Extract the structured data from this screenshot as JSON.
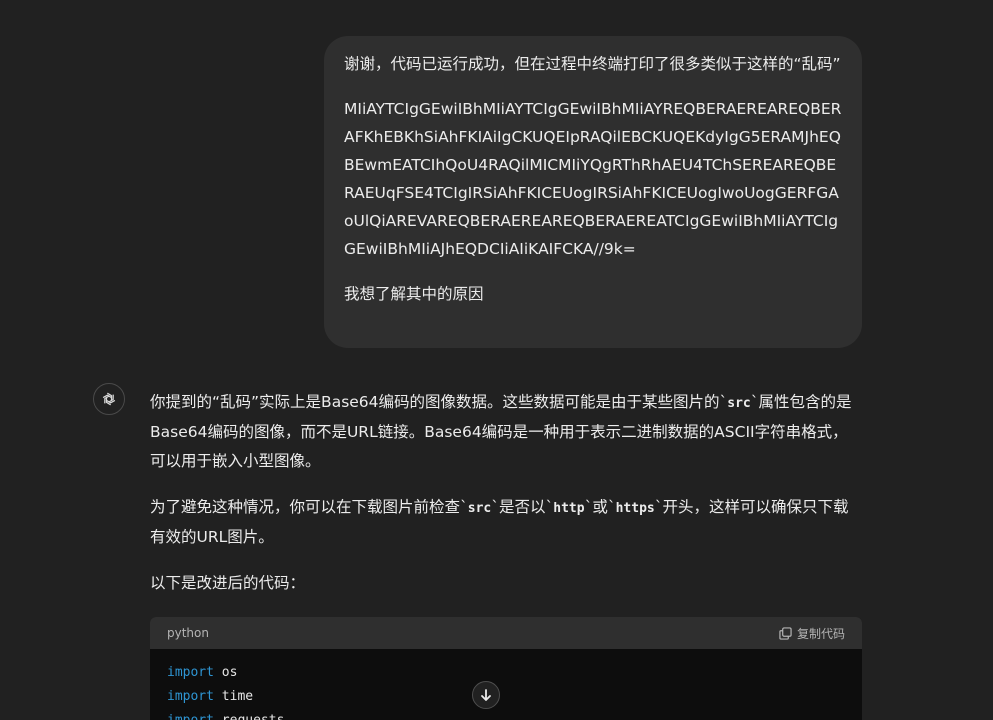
{
  "user_message": {
    "line1": "谢谢，代码已运行成功，但在过程中终端打印了很多类似于这样的“乱码”",
    "base64": "MIiAYTCIgGEwiIBhMIiAYTCIgGEwiIBhMIiAYREQBERAEREAREQBERAFKhEBKhSiAhFKIAiIgCKUQEIpRAQilEBCKUQEKdyIgG5ERAMJhEQBEwmEATCIhQoU4RAQilMICMIiYQgRThRhAEU4TChSEREAREQBERAEUqFSE4TCIgIRSiAhFKICEUogIRSiAhFKICEUogIwoUogGERFGAoUlQiAREVAREQBERAEREAREQBERAEREATCIgGEwiIBhMIiAYTCIgGEwiIBhMIiAJhEQDCIiAIiKAIFCKA//9k=",
    "line3": "我想了解其中的原因"
  },
  "assistant": {
    "p1_a": "你提到的“乱码”实际上是Base64编码的图像数据。这些数据可能是由于某些图片的`",
    "p1_code": "src",
    "p1_b": "`属性包含的是Base64编码的图像，而不是URL链接。Base64编码是一种用于表示二进制数据的ASCII字符串格式，可以用于嵌入小型图像。",
    "p2_a": "为了避免这种情况，你可以在下载图片前检查`",
    "p2_code1": "src",
    "p2_b": "`是否以`",
    "p2_code2": "http",
    "p2_c": "`或`",
    "p2_code3": "https",
    "p2_d": "`开头，这样可以确保只下载有效的URL图片。",
    "p3": "以下是改进后的代码："
  },
  "code_block": {
    "language": "python",
    "copy_label": "复制代码",
    "lines": [
      {
        "kw": "import",
        "rest": " os"
      },
      {
        "kw": "import",
        "rest": " time"
      },
      {
        "kw": "import",
        "rest": " requests"
      }
    ]
  },
  "colors": {
    "background": "#212121",
    "bubble": "#2f2f2f",
    "code_bg": "#0d0d0d",
    "keyword": "#2e95d3"
  }
}
